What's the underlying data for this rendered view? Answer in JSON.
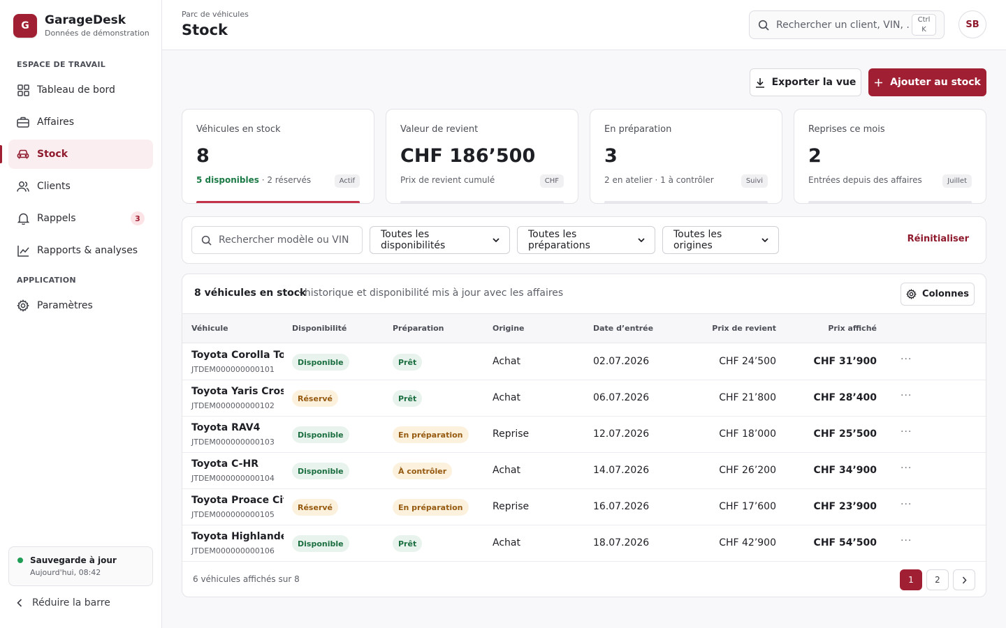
{
  "brand": {
    "logo_letter": "G",
    "name": "GarageDesk",
    "subtitle": "Données de démonstration"
  },
  "sidebar": {
    "section_workspace": "ESPACE DE TRAVAIL",
    "section_app": "APPLICATION",
    "items": [
      {
        "label": "Tableau de bord",
        "icon": "dashboard-icon"
      },
      {
        "label": "Affaires",
        "icon": "briefcase-icon"
      },
      {
        "label": "Stock",
        "icon": "car-icon",
        "active": true
      },
      {
        "label": "Clients",
        "icon": "users-icon"
      },
      {
        "label": "Rappels",
        "icon": "bell-icon",
        "badge": "3"
      },
      {
        "label": "Rapports & analyses",
        "icon": "chart-icon"
      },
      {
        "label": "Paramètres",
        "icon": "settings-icon"
      }
    ],
    "save_status": {
      "title": "Sauvegarde à jour",
      "time": "Aujourd'hui, 08:42"
    },
    "collapse_label": "Réduire la barre"
  },
  "header": {
    "breadcrumb": "Parc de véhicules",
    "title": "Stock",
    "search_placeholder": "Rechercher un client, VIN, ...",
    "kbd_top": "Ctrl",
    "kbd_bottom": "K",
    "avatar_initials": "SB"
  },
  "actions": {
    "export_label": "Exporter la vue",
    "add_label": "Ajouter au stock"
  },
  "kpis": [
    {
      "label": "Véhicules en stock",
      "value": "8",
      "foot_highlight": "5 disponibles",
      "foot": "· 2 réservés",
      "tag": "Actif",
      "progress": 1.0
    },
    {
      "label": "Valeur de revient",
      "value": "CHF 186’500",
      "foot": "Prix de revient cumulé",
      "tag": "CHF",
      "progress": 0
    },
    {
      "label": "En préparation",
      "value": "3",
      "foot": "2 en atelier · 1 à contrôler",
      "tag": "Suivi",
      "progress": 0
    },
    {
      "label": "Reprises ce mois",
      "value": "2",
      "foot": "Entrées depuis des affaires",
      "tag": "Juillet",
      "progress": 0
    }
  ],
  "filters": {
    "search_placeholder": "Rechercher modèle ou VIN",
    "availability": "Toutes les disponibilités",
    "preparation": "Toutes les préparations",
    "origin": "Toutes les origines",
    "reset_label": "Réinitialiser"
  },
  "table": {
    "title": "8 véhicules en stock",
    "subtitle": "· historique et disponibilité mis à jour avec les affaires",
    "columns_label": "Colonnes",
    "headers": [
      "Véhicule",
      "Disponibilité",
      "Préparation",
      "Origine",
      "Date d’entrée",
      "Prix de revient",
      "Prix affiché"
    ],
    "rows": [
      {
        "name": "Toyota Corolla Touring Sports",
        "vin": "JTDEM000000000101",
        "availability": "Disponible",
        "preparation": "Prêt",
        "origin": "Achat",
        "date": "02.07.2026",
        "cost": "CHF 24’500",
        "price": "CHF 31’900"
      },
      {
        "name": "Toyota Yaris Cross",
        "vin": "JTDEM000000000102",
        "availability": "Réservé",
        "preparation": "Prêt",
        "origin": "Achat",
        "date": "06.07.2026",
        "cost": "CHF 21’800",
        "price": "CHF 28’400"
      },
      {
        "name": "Toyota RAV4",
        "vin": "JTDEM000000000103",
        "availability": "Disponible",
        "preparation": "En préparation",
        "origin": "Reprise",
        "date": "12.07.2026",
        "cost": "CHF 18’000",
        "price": "CHF 25’500"
      },
      {
        "name": "Toyota C-HR",
        "vin": "JTDEM000000000104",
        "availability": "Disponible",
        "preparation": "À contrôler",
        "origin": "Achat",
        "date": "14.07.2026",
        "cost": "CHF 26’200",
        "price": "CHF 34’900"
      },
      {
        "name": "Toyota Proace City",
        "vin": "JTDEM000000000105",
        "availability": "Réservé",
        "preparation": "En préparation",
        "origin": "Reprise",
        "date": "16.07.2026",
        "cost": "CHF 17’600",
        "price": "CHF 23’900"
      },
      {
        "name": "Toyota Highlander",
        "vin": "JTDEM000000000106",
        "availability": "Disponible",
        "preparation": "Prêt",
        "origin": "Achat",
        "date": "18.07.2026",
        "cost": "CHF 42’900",
        "price": "CHF 54’500"
      }
    ],
    "more_label": "···",
    "footer": "6 véhicules affichés sur 8",
    "pages": [
      "1",
      "2"
    ]
  },
  "colors": {
    "accent": "#a11f33",
    "green": "#1b6e40",
    "amber": "#95590f"
  }
}
